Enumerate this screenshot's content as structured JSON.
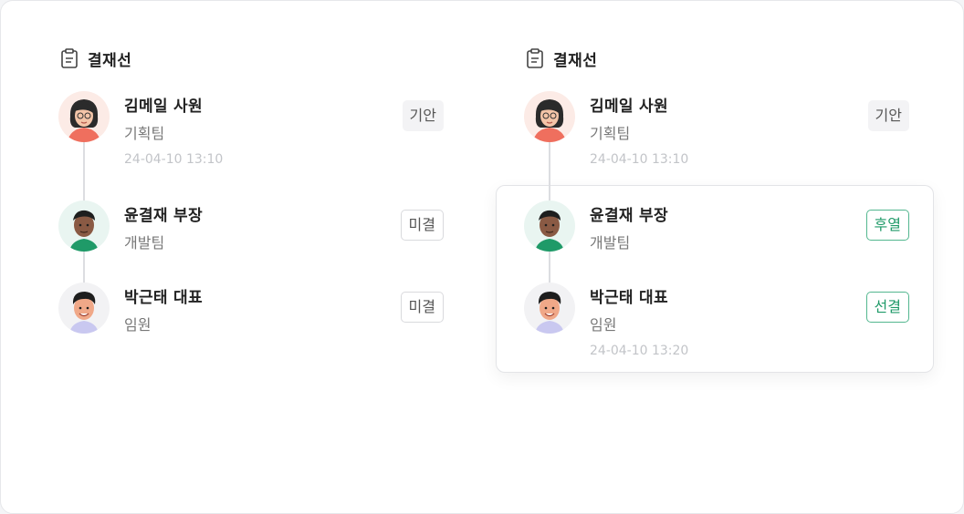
{
  "panels": [
    {
      "header": "결재선",
      "icon": "clipboard-icon",
      "approvers": [
        {
          "name": "김메일 사원",
          "dept": "기획팀",
          "time": "24-04-10 13:10",
          "status": "기안",
          "avatar": "female-avatar-icon"
        },
        {
          "name": "윤결재 부장",
          "dept": "개발팀",
          "time": "",
          "status": "미결",
          "avatar": "male-avatar-icon"
        },
        {
          "name": "박근태 대표",
          "dept": "임원",
          "time": "",
          "status": "미결",
          "avatar": "male-avatar-icon"
        }
      ]
    },
    {
      "header": "결재선",
      "icon": "clipboard-icon",
      "approvers": [
        {
          "name": "김메일 사원",
          "dept": "기획팀",
          "time": "24-04-10 13:10",
          "status": "기안",
          "avatar": "female-avatar-icon"
        },
        {
          "name": "윤결재 부장",
          "dept": "개발팀",
          "time": "",
          "status": "후열",
          "avatar": "male-avatar-icon"
        },
        {
          "name": "박근태 대표",
          "dept": "임원",
          "time": "24-04-10 13:20",
          "status": "선결",
          "avatar": "male-avatar-icon"
        }
      ]
    }
  ],
  "colors": {
    "accent_green": "#1f9a68",
    "border_green": "#53b78f",
    "muted": "#c2c4c8"
  }
}
